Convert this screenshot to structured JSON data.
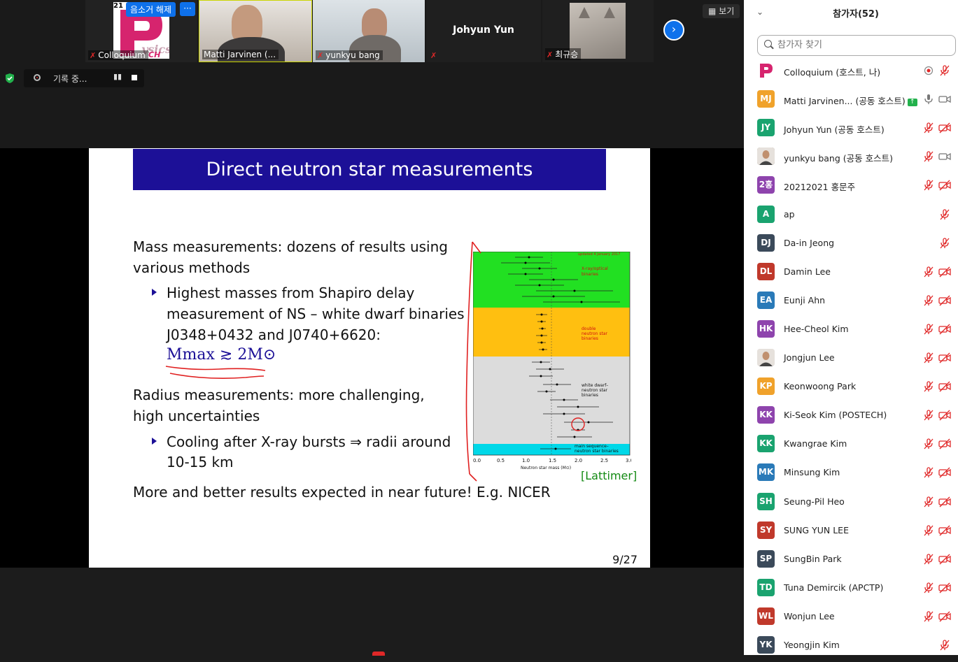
{
  "video_strip": {
    "tiles": [
      {
        "name": "Colloquium",
        "muted": true,
        "logo_letters": "21 S",
        "overlay_letters": "CH"
      },
      {
        "name": "Matti Jarvinen (...",
        "muted": false,
        "active_speaker": true
      },
      {
        "name": "yunkyu bang",
        "muted": true
      },
      {
        "name": "Johyun Yun",
        "muted": true,
        "name_only": true
      },
      {
        "name": "최규승",
        "muted": true
      }
    ],
    "unmute_label": "음소거 해제",
    "more_label": "···",
    "next_icon": "chevron-right-icon",
    "view_label": "보기"
  },
  "recording": {
    "label": "기록 중...",
    "pause": "▮▮"
  },
  "slide": {
    "title": "Direct neutron star measurements",
    "para1_line1": "Mass measurements: dozens of results using",
    "para1_line2": "various methods",
    "b1_line1": "Highest masses from Shapiro delay",
    "b1_line2": "measurement of NS – white dwarf binaries",
    "b1_line3": "J0348+0432 and J0740+6620:",
    "b1_math": "Mmax ≳ 2M⊙",
    "para2_line1": "Radius measurements: more challenging,",
    "para2_line2": "high uncertainties",
    "b2_line1": "Cooling after X-ray bursts ⇒ radii around",
    "b2_line2": "10-15 km",
    "para3": "More and better results expected in near future! E.g. NICER",
    "citation": "[Lattimer]",
    "page": "9/27",
    "chart_labels": {
      "updated": "updated 4 January 2017",
      "xray": "X-ray/optical",
      "xray2": "binaries",
      "dns": "double",
      "dns2": "neutron star",
      "dns3": "binaries",
      "wd": "white dwarf–",
      "wd2": "neutron star",
      "wd3": "binaries",
      "ms": "main sequence–",
      "ms2": "neutron star binaries",
      "xlabel": "Neutron star mass (M⊙)",
      "ticks": [
        "0.0",
        "0.5",
        "1.0",
        "1.5",
        "2.0",
        "2.5",
        "3.0"
      ]
    }
  },
  "participants": {
    "title": "참가자(52)",
    "search_placeholder": "참가자 찾기",
    "list": [
      {
        "initials": "P",
        "name": "Colloquium (호스트, 나)",
        "color": "#ffffff",
        "logo": true,
        "icons": [
          "record",
          "mic-muted"
        ]
      },
      {
        "initials": "MJ",
        "name": "Matti Jarvinen... (공동 호스트)",
        "color": "#f0a22b",
        "share": true,
        "icons": [
          "mic",
          "video"
        ]
      },
      {
        "initials": "JY",
        "name": "Johyun Yun (공동 호스트)",
        "color": "#1aa36f",
        "icons": [
          "mic-muted",
          "video-off"
        ]
      },
      {
        "initials": "",
        "name": "yunkyu bang (공동 호스트)",
        "color": "#8a7a6a",
        "photo": true,
        "icons": [
          "mic-muted",
          "video"
        ]
      },
      {
        "initials": "2홍",
        "name": "20212021 홍문주",
        "color": "#8e44ad",
        "icons": [
          "mic-muted",
          "video-off"
        ]
      },
      {
        "initials": "A",
        "name": "ap",
        "color": "#1aa36f",
        "icons": [
          "",
          "mic-muted"
        ]
      },
      {
        "initials": "DJ",
        "name": "Da-in Jeong",
        "color": "#3b4a5a",
        "icons": [
          "",
          "mic-muted"
        ]
      },
      {
        "initials": "DL",
        "name": "Damin Lee",
        "color": "#c0392b",
        "icons": [
          "mic-muted",
          "video-off"
        ]
      },
      {
        "initials": "EA",
        "name": "Eunji Ahn",
        "color": "#2a7ab8",
        "icons": [
          "mic-muted",
          "video-off"
        ]
      },
      {
        "initials": "HK",
        "name": "Hee-Cheol Kim",
        "color": "#8e44ad",
        "icons": [
          "mic-muted",
          "video-off"
        ]
      },
      {
        "initials": "",
        "name": "Jongjun Lee",
        "color": "#ddd",
        "photo": true,
        "icons": [
          "mic-muted",
          "video-off"
        ]
      },
      {
        "initials": "KP",
        "name": "Keonwoong Park",
        "color": "#f0a22b",
        "icons": [
          "mic-muted",
          "video-off"
        ]
      },
      {
        "initials": "KK",
        "name": "Ki-Seok Kim (POSTECH)",
        "color": "#8e44ad",
        "icons": [
          "mic-muted",
          "video-off"
        ]
      },
      {
        "initials": "KK",
        "name": "Kwangrae Kim",
        "color": "#1aa36f",
        "icons": [
          "mic-muted",
          "video-off"
        ]
      },
      {
        "initials": "MK",
        "name": "Minsung Kim",
        "color": "#2a7ab8",
        "icons": [
          "mic-muted",
          "video-off"
        ]
      },
      {
        "initials": "SH",
        "name": "Seung-Pil Heo",
        "color": "#1aa36f",
        "icons": [
          "mic-muted",
          "video-off"
        ]
      },
      {
        "initials": "SY",
        "name": "SUNG YUN LEE",
        "color": "#c0392b",
        "icons": [
          "mic-muted",
          "video-off"
        ]
      },
      {
        "initials": "SP",
        "name": "SungBin Park",
        "color": "#3b4a5a",
        "icons": [
          "mic-muted",
          "video-off"
        ]
      },
      {
        "initials": "TD",
        "name": "Tuna Demircik (APCTP)",
        "color": "#1aa36f",
        "icons": [
          "mic-muted",
          "video-off"
        ]
      },
      {
        "initials": "WL",
        "name": "Wonjun Lee",
        "color": "#c0392b",
        "icons": [
          "mic-muted",
          "video-off"
        ]
      },
      {
        "initials": "YK",
        "name": "Yeongjin Kim",
        "color": "#3b4a5a",
        "icons": [
          "",
          "mic-muted"
        ]
      }
    ]
  }
}
